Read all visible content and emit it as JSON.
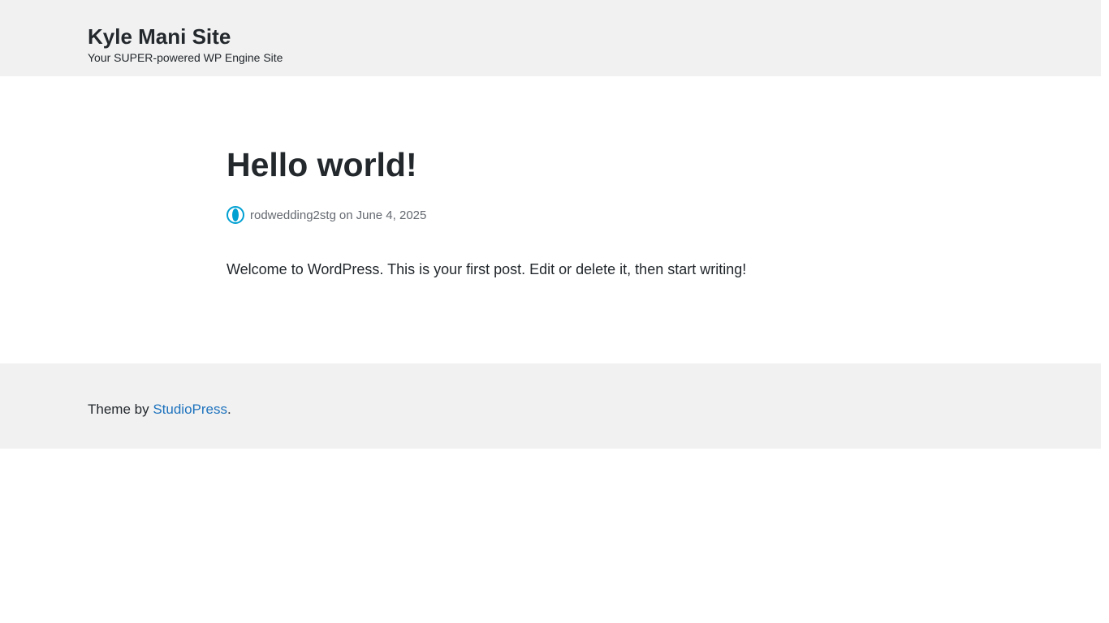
{
  "header": {
    "site_title": "Kyle Mani Site",
    "tagline": "Your SUPER-powered WP Engine Site",
    "background": "#f1f1f1"
  },
  "post": {
    "title": "Hello world!",
    "author": "rodwedding2stg",
    "date_prefix": "on",
    "date": "June 4, 2025",
    "avatar_icon": "avatar-icon",
    "avatar_color": "#00a0d2",
    "content": "Welcome to WordPress. This is your first post. Edit or delete it, then start writing!"
  },
  "footer": {
    "prefix": "Theme by",
    "link_label": "StudioPress",
    "suffix": ".",
    "link_color": "#1e73be",
    "background": "#f1f1f1"
  }
}
